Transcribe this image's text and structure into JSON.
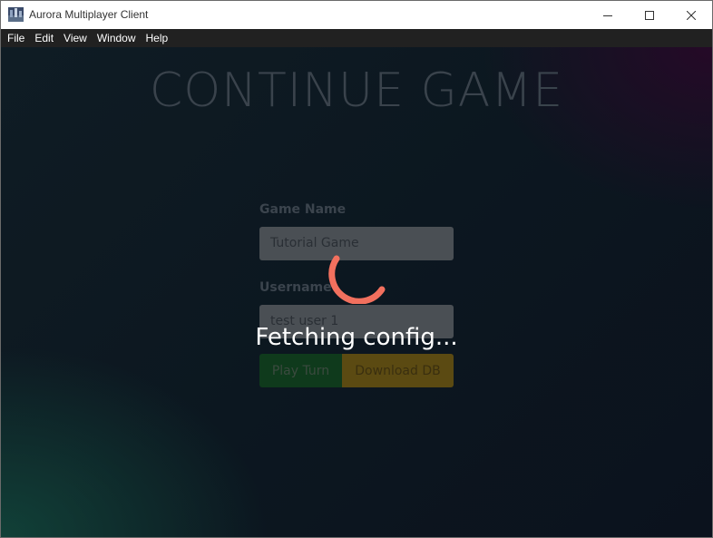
{
  "window": {
    "title": "Aurora Multiplayer Client",
    "icon": "aurora-app-icon",
    "controls": [
      "minimize",
      "maximize",
      "close"
    ]
  },
  "menu": {
    "items": [
      "File",
      "Edit",
      "View",
      "Window",
      "Help"
    ]
  },
  "page": {
    "title": "CONTINUE GAME",
    "game_name_label": "Game Name",
    "game_name_value": "Tutorial Game",
    "username_label": "Username",
    "username_value": "test user 1",
    "play_button": "Play Turn",
    "download_button": "Download DB"
  },
  "overlay": {
    "loading_text": "Fetching config...",
    "spinner_color": "#f2705e"
  },
  "colors": {
    "menubar_bg": "#212121",
    "play_button_bg": "#0f3a1c",
    "download_button_bg": "#5b4a12"
  }
}
